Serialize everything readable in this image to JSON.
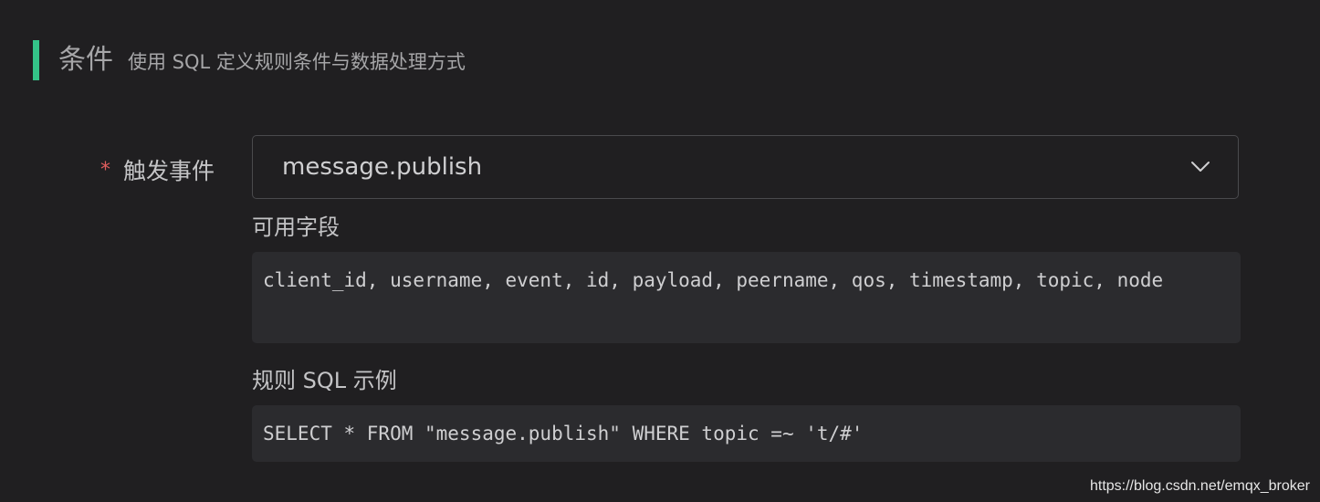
{
  "section": {
    "title": "条件",
    "subtitle": "使用 SQL 定义规则条件与数据处理方式"
  },
  "form": {
    "required_mark": "*",
    "event_label": "触发事件",
    "event_value": "message.publish",
    "fields_label": "可用字段",
    "fields_value": "client_id, username, event, id, payload, peername, qos, timestamp, topic, node",
    "sql_example_label": "规则 SQL 示例",
    "sql_example_value": "SELECT * FROM \"message.publish\" WHERE topic =~ 't/#'"
  },
  "icons": {
    "dropdown": "chevron-down-icon"
  },
  "colors": {
    "accent": "#34c388",
    "required": "#e05d5d",
    "background": "#201f21",
    "code_background": "#2b2b2e"
  },
  "watermark": "https://blog.csdn.net/emqx_broker"
}
